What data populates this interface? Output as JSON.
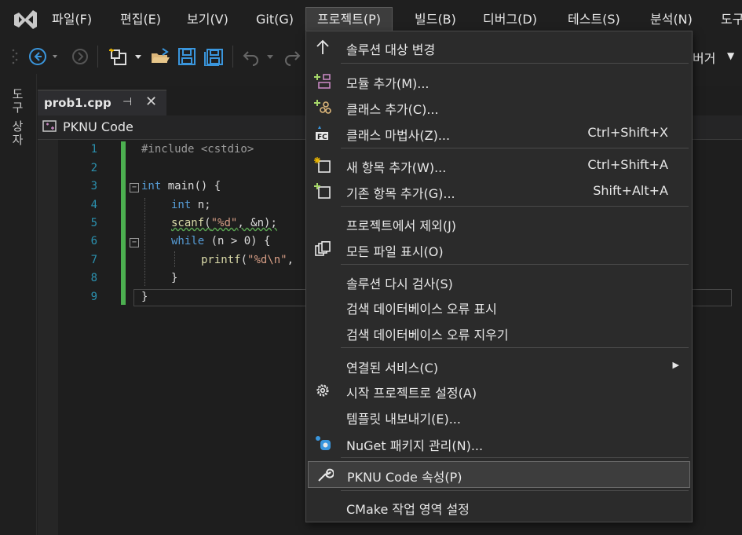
{
  "menubar": {
    "items": [
      "파일(F)",
      "편집(E)",
      "보기(V)",
      "Git(G)",
      "프로젝트(P)",
      "빌드(B)",
      "디버그(D)",
      "테스트(S)",
      "분석(N)",
      "도구"
    ]
  },
  "toolbar": {
    "debugger_label": "버거"
  },
  "toolstrip": {
    "toolbox_label": "도구 상자"
  },
  "tab": {
    "title": "prob1.cpp"
  },
  "navbar": {
    "project": "PKNU Code"
  },
  "code": {
    "line_numbers": [
      "1",
      "2",
      "3",
      "4",
      "5",
      "6",
      "7",
      "8",
      "9"
    ],
    "l1_pp": "#include <cstdio>",
    "l3_kw": "int",
    "l3_rest": " main() {",
    "l4_kw": "int",
    "l4_rest": " n;",
    "l5_fn": "scanf",
    "l5_p1": "(",
    "l5_str": "\"%d\"",
    "l5_rest": ", &n);",
    "l6_kw": "while",
    "l6_rest": " (n > 0) {",
    "l7_fn": "printf",
    "l7_p1": "(",
    "l7_str": "\"%d\\n\"",
    "l7_rest": ",",
    "l8": "}",
    "l9": "}"
  },
  "dropdown": {
    "items": [
      {
        "label": "솔루션 대상 변경",
        "shortcut": "",
        "icon": "arrow-up-icon"
      },
      {
        "label": "모듈 추가(M)...",
        "shortcut": "",
        "icon": "add-module-icon"
      },
      {
        "label": "클래스 추가(C)...",
        "shortcut": "",
        "icon": "add-class-icon"
      },
      {
        "label": "클래스 마법사(Z)...",
        "shortcut": "Ctrl+Shift+X",
        "icon": "class-wizard-icon"
      },
      {
        "label": "새 항목 추가(W)...",
        "shortcut": "Ctrl+Shift+A",
        "icon": "new-item-icon"
      },
      {
        "label": "기존 항목 추가(G)...",
        "shortcut": "Shift+Alt+A",
        "icon": "existing-item-icon"
      },
      {
        "label": "프로젝트에서 제외(J)",
        "shortcut": "",
        "icon": ""
      },
      {
        "label": "모든 파일 표시(O)",
        "shortcut": "",
        "icon": "show-all-files-icon"
      },
      {
        "label": "솔루션 다시 검사(S)",
        "shortcut": "",
        "icon": ""
      },
      {
        "label": "검색 데이터베이스 오류 표시",
        "shortcut": "",
        "icon": ""
      },
      {
        "label": "검색 데이터베이스 오류 지우기",
        "shortcut": "",
        "icon": ""
      },
      {
        "label": "연결된 서비스(C)",
        "shortcut": "",
        "icon": "",
        "submenu": "▶"
      },
      {
        "label": "시작 프로젝트로 설정(A)",
        "shortcut": "",
        "icon": "gear-icon"
      },
      {
        "label": "템플릿 내보내기(E)...",
        "shortcut": "",
        "icon": ""
      },
      {
        "label": "NuGet 패키지 관리(N)...",
        "shortcut": "",
        "icon": "nuget-icon"
      },
      {
        "label": "PKNU Code 속성(P)",
        "shortcut": "",
        "icon": "wrench-icon"
      },
      {
        "label": "CMake 작업 영역 설정",
        "shortcut": "",
        "icon": ""
      }
    ]
  },
  "colors": {
    "accent": "#4caf50",
    "line_number": "#2b91af",
    "keyword": "#569cd6",
    "string": "#d69d85"
  }
}
